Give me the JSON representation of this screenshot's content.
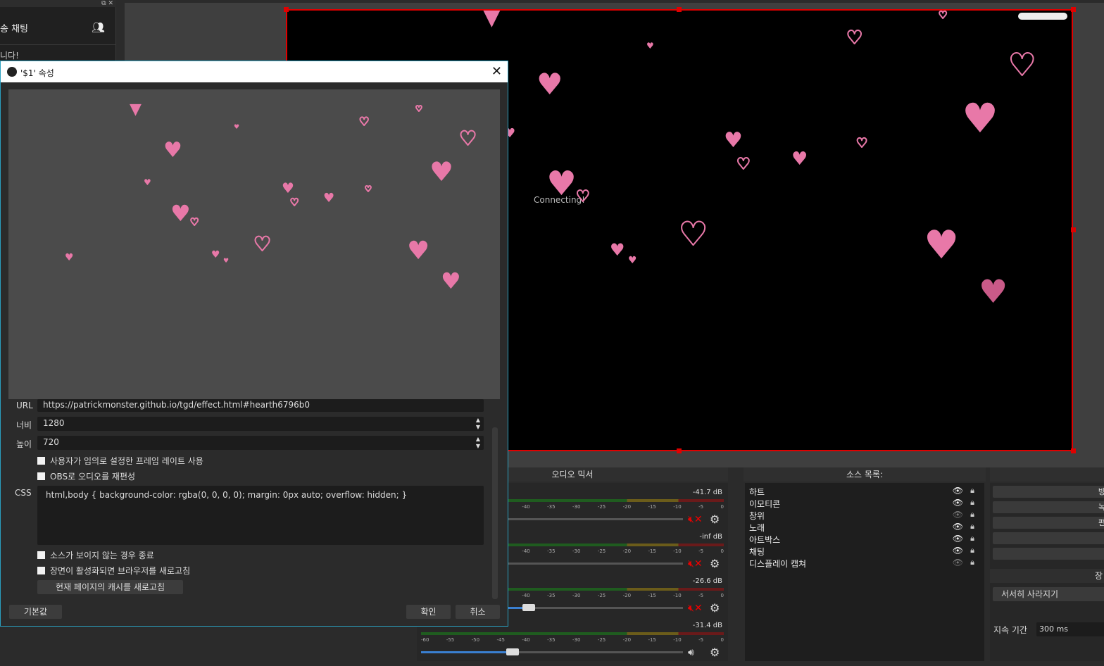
{
  "chat": {
    "close_glyphs": "⧉ ✕",
    "title": "송 채팅",
    "message": "니다!"
  },
  "preview": {
    "connecting": "Connecting!"
  },
  "dialog": {
    "title": "'$1' 속성",
    "url_label": "URL",
    "url_value": "https://patrickmonster.github.io/tgd/effect.html#hearth6796b0",
    "width_label": "너비",
    "width_value": "1280",
    "height_label": "높이",
    "height_value": "720",
    "chk_fps": "사용자가 임의로 설정한 프레임 레이트 사용",
    "chk_audio": "OBS로 오디오를 재편성",
    "css_label": "CSS",
    "css_value": "html,body { background-color: rgba(0, 0, 0, 0); margin: 0px auto; overflow: hidden; }",
    "chk_shutdown": "소스가 보이지 않는 경우 종료",
    "chk_refresh": "장면이 활성화되면 브라우저를 새로고침",
    "refresh_cache_btn": "현재 페이지의 캐시를 새로고침",
    "defaults_btn": "기본값",
    "ok_btn": "확인",
    "cancel_btn": "취소"
  },
  "mixer": {
    "title": "오디오 믹서",
    "ticks": [
      "-60",
      "-55",
      "-50",
      "-45",
      "-40",
      "-35",
      "-30",
      "-25",
      "-20",
      "-15",
      "-10",
      "-5",
      "0"
    ],
    "rows": [
      {
        "db": "-41.7 dB",
        "muted": true,
        "level": 0.0
      },
      {
        "db": "-inf dB",
        "muted": true,
        "level": 0.0
      },
      {
        "db": "-26.6 dB",
        "muted": true,
        "level": 0.41
      },
      {
        "db": "-31.4 dB",
        "muted": false,
        "level": 0.35
      }
    ]
  },
  "sources": {
    "title": "소스 목록:",
    "items": [
      {
        "name": "하트",
        "visible": true
      },
      {
        "name": "이모티콘",
        "visible": true
      },
      {
        "name": "창위",
        "visible": false
      },
      {
        "name": "노래",
        "visible": true
      },
      {
        "name": "아트박스",
        "visible": true
      },
      {
        "name": "채팅",
        "visible": true
      },
      {
        "name": "디스플레이 캡쳐",
        "visible": false
      }
    ]
  },
  "controls": {
    "buttons": [
      "방",
      "녹",
      "편",
      "",
      "",
      ""
    ],
    "scene_label": "장",
    "transition": "서서히 사라지기",
    "duration_label": "지속 기간",
    "duration_value": "300 ms"
  },
  "colors": {
    "accent": "#e878a8",
    "selection": "#e00000",
    "dialog_border": "#2aa0c0"
  }
}
